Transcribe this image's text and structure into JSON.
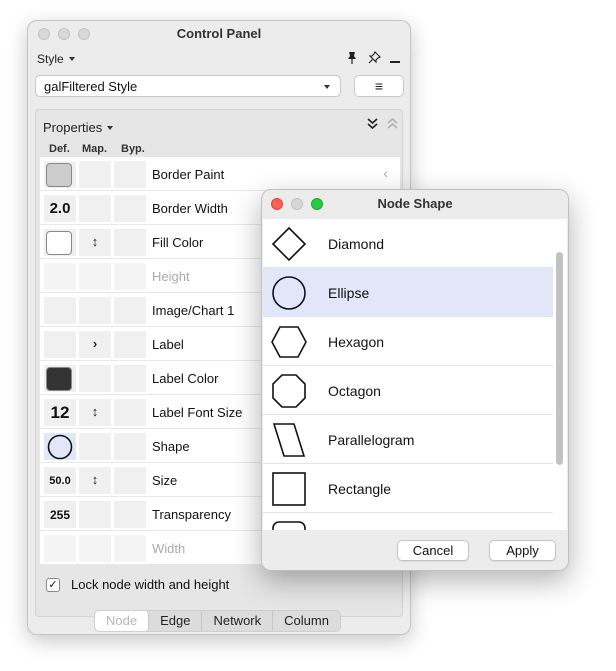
{
  "control_panel": {
    "title": "Control Panel",
    "style_menu_label": "Style",
    "icons": [
      "pin-icon",
      "pushpin-icon",
      "minimize-icon"
    ],
    "style_select_value": "galFiltered Style",
    "hamburger_icon": "≡",
    "properties": {
      "title": "Properties",
      "columns": {
        "def": "Def.",
        "map": "Map.",
        "byp": "Byp."
      },
      "rows": [
        {
          "name": "Border Paint",
          "def_type": "swatch",
          "def_color": "#cccccc",
          "map_icon": ""
        },
        {
          "name": "Border Width",
          "def_type": "number",
          "def_value": "2.0",
          "map_icon": ""
        },
        {
          "name": "Fill Color",
          "def_type": "swatch",
          "def_color": "#ffffff",
          "map_icon": "↕"
        },
        {
          "name": "Height",
          "def_type": "none",
          "map_icon": "",
          "disabled": true
        },
        {
          "name": "Image/Chart 1",
          "def_type": "none",
          "map_icon": ""
        },
        {
          "name": "Label",
          "def_type": "none",
          "map_icon": "›"
        },
        {
          "name": "Label Color",
          "def_type": "swatch",
          "def_color": "#333333",
          "map_icon": ""
        },
        {
          "name": "Label Font Size",
          "def_type": "number",
          "def_value": "12",
          "map_icon": "↕"
        },
        {
          "name": "Shape",
          "def_type": "shape",
          "map_icon": ""
        },
        {
          "name": "Size",
          "def_type": "number",
          "def_value": "50.0",
          "map_icon": "↕"
        },
        {
          "name": "Transparency",
          "def_type": "number",
          "def_value": "255",
          "map_icon": ""
        },
        {
          "name": "Width",
          "def_type": "none",
          "map_icon": "",
          "disabled": true
        }
      ],
      "lock_label": "Lock node width and height",
      "lock_checked": true
    },
    "tabs": [
      "Node",
      "Edge",
      "Network",
      "Column"
    ],
    "active_tab": "Node"
  },
  "node_shape_dialog": {
    "title": "Node Shape",
    "shapes": [
      "Diamond",
      "Ellipse",
      "Hexagon",
      "Octagon",
      "Parallelogram",
      "Rectangle"
    ],
    "selected": "Ellipse",
    "cancel_label": "Cancel",
    "apply_label": "Apply",
    "selection_color": "#e1e6f8"
  }
}
